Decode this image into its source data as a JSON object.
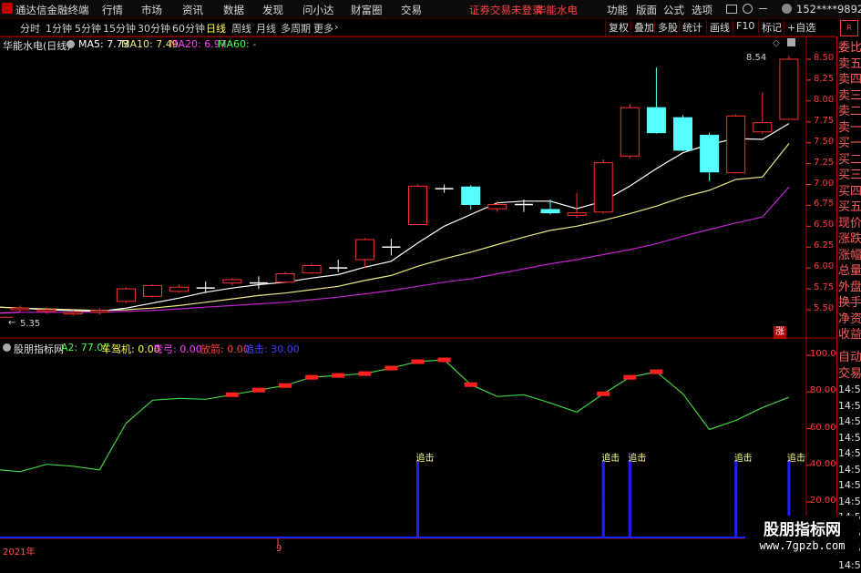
{
  "app": {
    "title": "通达信金融终端",
    "menu": [
      "行情",
      "市场",
      "资讯",
      "数据",
      "发现",
      "问小达",
      "财富圈",
      "交易"
    ],
    "notice": "证券交易未登录",
    "stock_name_top": "华能水电",
    "right_menu": [
      "功能",
      "版面",
      "公式",
      "选项"
    ],
    "user": "152****9892"
  },
  "periods": [
    "分时",
    "1分钟",
    "5分钟",
    "15分钟",
    "30分钟",
    "60分钟",
    "日线",
    "周线",
    "月线",
    "多周期",
    "更多"
  ],
  "active_period": "日线",
  "right_buttons": [
    "复权",
    "叠加",
    "多股",
    "统计",
    "画线",
    "F10",
    "标记",
    "+自选"
  ],
  "main": {
    "title": "华能水电(日线)",
    "ma": [
      {
        "label": "MA5: 7.73",
        "color": "#ffffff"
      },
      {
        "label": "MA10: 7.49",
        "color": "#e8e880"
      },
      {
        "label": "MA20: 6.97",
        "color": "#ff40ff"
      },
      {
        "label": "MA60: -",
        "color": "#40ff40"
      }
    ],
    "high_label": "8.54",
    "low_label": "5.35",
    "rise_badge": "涨"
  },
  "price_axis": [
    "8.50",
    "8.25",
    "8.00",
    "7.75",
    "7.50",
    "7.25",
    "7.00",
    "6.75",
    "6.50",
    "6.25",
    "6.00",
    "5.75",
    "5.50"
  ],
  "right_panel_top": [
    "委比",
    "卖五",
    "卖四",
    "卖三",
    "卖二",
    "卖一",
    "买一",
    "买二",
    "买三",
    "买四",
    "买五",
    "现价",
    "涨跌",
    "涨幅",
    "总量",
    "外盘",
    "换手",
    "净资",
    "收益"
  ],
  "right_panel_bottom": [
    "自动",
    "交易",
    "14:56",
    "14:56",
    "14:56",
    "14:56",
    "14:56",
    "14:56",
    "14:56",
    "14:56",
    "14:56",
    "14:56",
    "14:56",
    "14:56"
  ],
  "indicator": {
    "title": "股朋指标网",
    "a2": "A2: 77.07",
    "chemachi": "车驾机: 0.00",
    "qianggong": "弯弓: 0.00",
    "fangjian": "放箭: 0.00",
    "zhuiji": "追击: 30.00",
    "axis": [
      "100.0",
      "80.00",
      "60.00",
      "40.00",
      "20.00"
    ],
    "signal_label": "追击"
  },
  "date": {
    "year": "2021年",
    "month": "9"
  },
  "watermark": {
    "title": "股朋指标网",
    "url": "www.7gpzb.com"
  },
  "chart_data": {
    "type": "candlestick",
    "ylim": [
      5.35,
      8.6
    ],
    "candles": [
      [
        5.5,
        5.52,
        5.55,
        5.48
      ],
      [
        5.48,
        5.5,
        5.53,
        5.45
      ],
      [
        5.45,
        5.47,
        5.5,
        5.43
      ],
      [
        5.47,
        5.49,
        5.52,
        5.44
      ],
      [
        5.6,
        5.75,
        5.77,
        5.58
      ],
      [
        5.66,
        5.79,
        5.8,
        5.65
      ],
      [
        5.72,
        5.77,
        5.8,
        5.7
      ],
      [
        5.76,
        5.76,
        5.84,
        5.7
      ],
      [
        5.82,
        5.86,
        5.88,
        5.79
      ],
      [
        5.82,
        5.82,
        5.9,
        5.75
      ],
      [
        5.83,
        5.93,
        5.95,
        5.82
      ],
      [
        5.94,
        6.03,
        6.05,
        5.93
      ],
      [
        6.0,
        6.0,
        6.1,
        5.95
      ],
      [
        6.1,
        6.34,
        6.36,
        6.0
      ],
      [
        6.25,
        6.25,
        6.35,
        6.15
      ],
      [
        6.52,
        6.98,
        7.0,
        6.52
      ],
      [
        6.95,
        6.95,
        7.0,
        6.9
      ],
      [
        6.97,
        6.76,
        6.99,
        6.7
      ],
      [
        6.71,
        6.76,
        6.8,
        6.67
      ],
      [
        6.76,
        6.76,
        6.82,
        6.67
      ],
      [
        6.7,
        6.66,
        6.82,
        6.64
      ],
      [
        6.63,
        6.66,
        6.9,
        6.6
      ],
      [
        6.67,
        7.26,
        7.3,
        6.65
      ],
      [
        7.34,
        7.92,
        7.96,
        7.31
      ],
      [
        7.92,
        7.62,
        8.4,
        7.61
      ],
      [
        7.8,
        7.41,
        7.83,
        7.4
      ],
      [
        7.59,
        7.15,
        7.62,
        7.04
      ],
      [
        7.14,
        7.82,
        7.84,
        7.13
      ],
      [
        7.63,
        7.74,
        8.1,
        7.6
      ],
      [
        7.78,
        8.5,
        8.54,
        7.78
      ]
    ],
    "ma5": [
      5.52,
      5.5,
      5.49,
      5.48,
      5.52,
      5.58,
      5.64,
      5.71,
      5.76,
      5.8,
      5.83,
      5.88,
      5.92,
      6.01,
      6.08,
      6.3,
      6.5,
      6.64,
      6.78,
      6.8,
      6.8,
      6.71,
      6.8,
      6.98,
      7.19,
      7.38,
      7.48,
      7.55,
      7.54,
      7.73
    ],
    "ma10": [
      5.52,
      5.51,
      5.5,
      5.49,
      5.5,
      5.52,
      5.55,
      5.59,
      5.63,
      5.67,
      5.7,
      5.74,
      5.78,
      5.85,
      5.91,
      6.02,
      6.11,
      6.19,
      6.28,
      6.37,
      6.45,
      6.5,
      6.57,
      6.65,
      6.74,
      6.85,
      6.93,
      7.06,
      7.09,
      7.49
    ],
    "ma20": [
      5.47,
      5.47,
      5.47,
      5.47,
      5.48,
      5.49,
      5.51,
      5.53,
      5.55,
      5.57,
      5.59,
      5.62,
      5.65,
      5.69,
      5.73,
      5.78,
      5.83,
      5.87,
      5.93,
      5.99,
      6.05,
      6.1,
      6.16,
      6.22,
      6.29,
      6.38,
      6.46,
      6.54,
      6.61,
      6.97
    ],
    "a2": [
      36.5,
      40.5,
      39.5,
      37.5,
      63,
      75.5,
      76.5,
      76,
      78.5,
      81,
      83.5,
      88,
      89,
      90,
      93,
      96.5,
      97.5,
      84,
      77.5,
      78.5,
      74,
      69,
      79,
      88,
      91,
      79,
      59.5,
      64.5,
      71.5,
      77.07
    ],
    "a2_highlight": [
      8,
      9,
      10,
      11,
      12,
      13,
      14,
      15,
      16,
      17,
      22,
      23,
      24
    ],
    "zhuiji": [
      0,
      0,
      0,
      0,
      0,
      0,
      0,
      0,
      0,
      0,
      0,
      0,
      0,
      0,
      0,
      30,
      0,
      0,
      0,
      0,
      0,
      0,
      30,
      30,
      0,
      0,
      0,
      30,
      0,
      30
    ]
  }
}
